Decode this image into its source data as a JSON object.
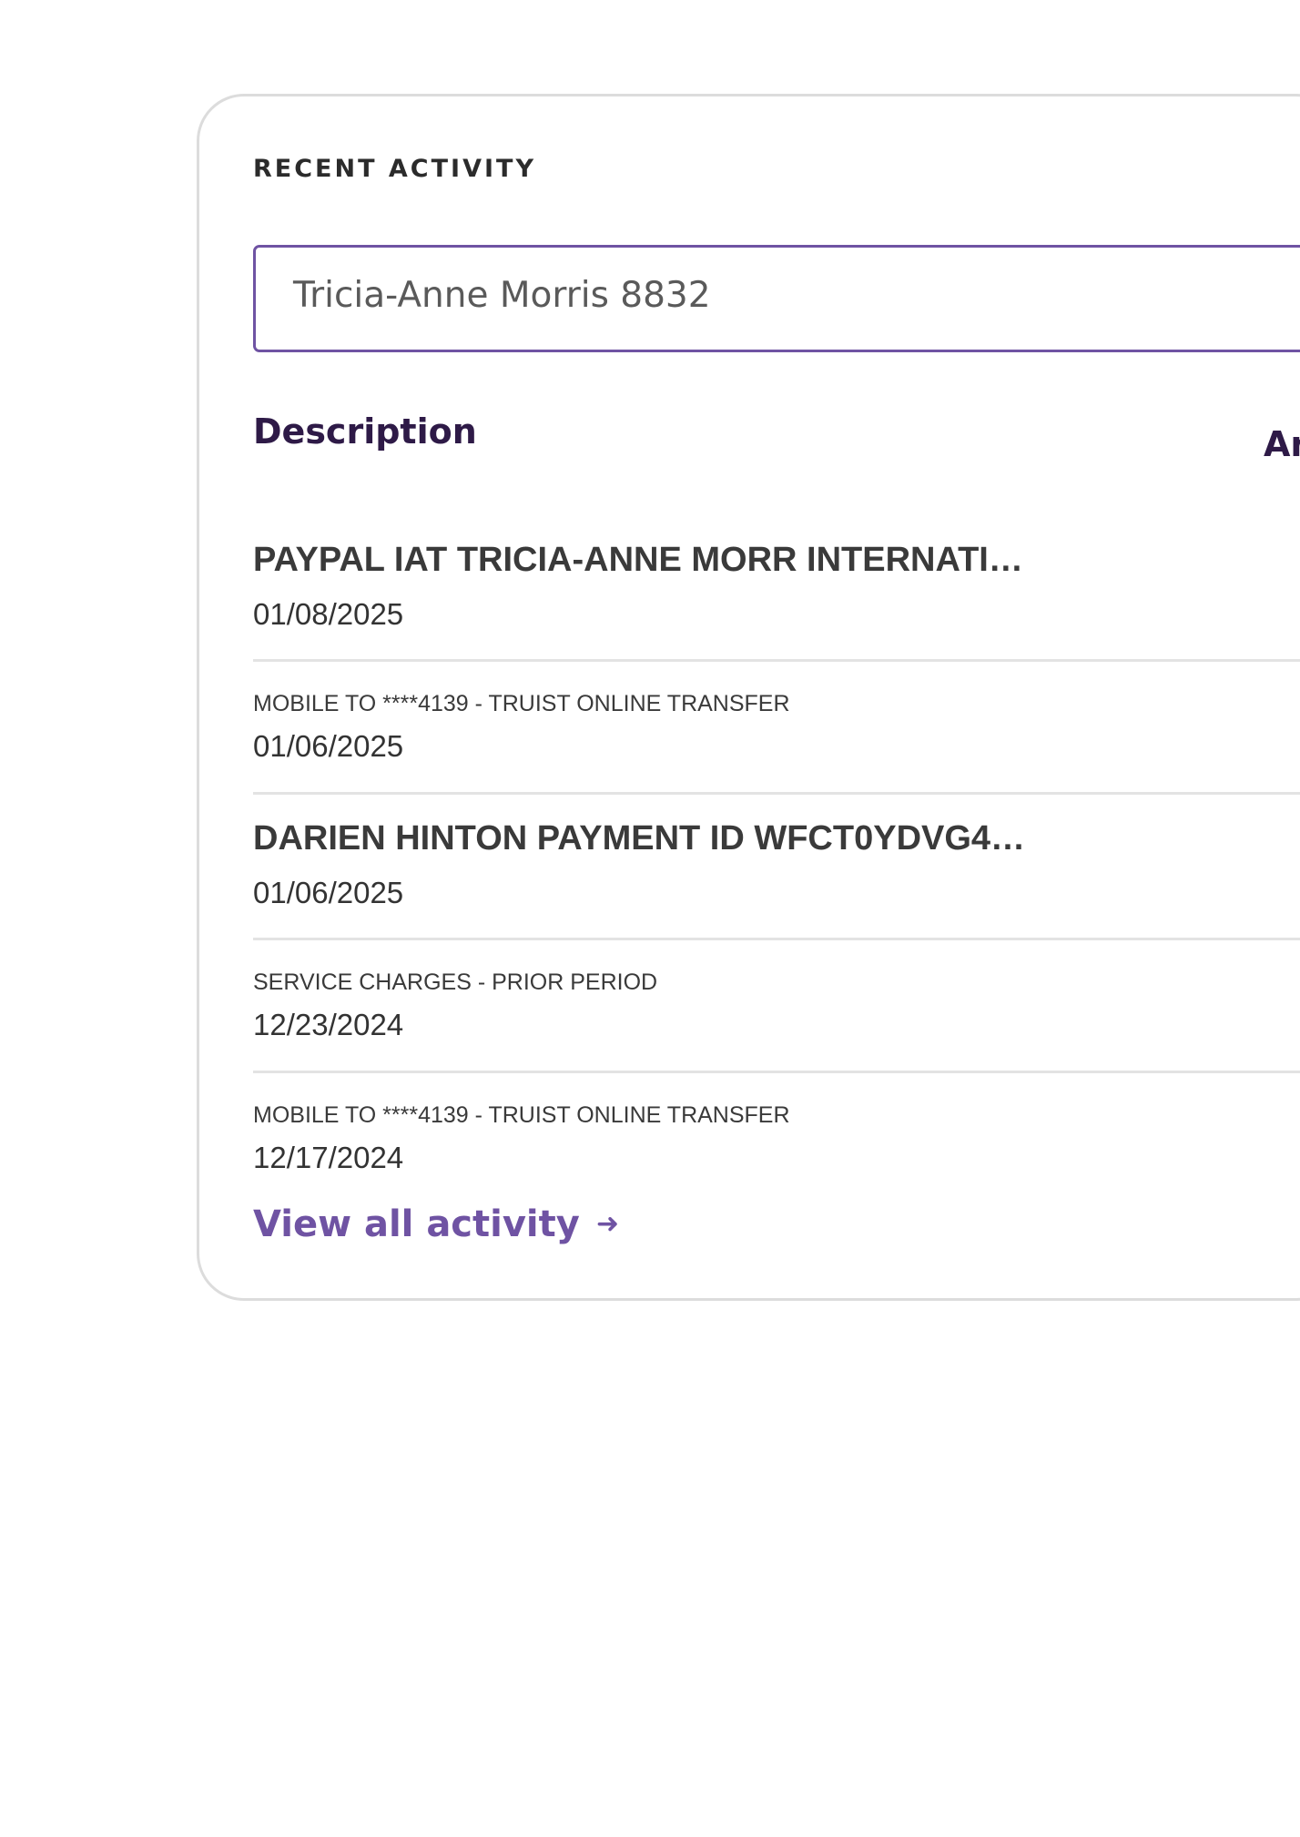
{
  "recent_activity": {
    "title": "RECENT ACTIVITY",
    "account_select": {
      "value": "Tricia-Anne Morris 8832"
    },
    "columns": {
      "description": "Description",
      "amount": "Ar"
    },
    "transactions": [
      {
        "description": "PAYPAL IAT TRICIA-ANNE MORR INTERNATI…",
        "date": "01/08/2025"
      },
      {
        "description": "MOBILE TO ****4139 - TRUIST ONLINE TRANSFER",
        "date": "01/06/2025"
      },
      {
        "description": "DARIEN HINTON PAYMENT ID WFCT0YDVG4…",
        "date": "01/06/2025"
      },
      {
        "description": "SERVICE CHARGES - PRIOR PERIOD",
        "date": "12/23/2024"
      },
      {
        "description": "MOBILE TO ****4139 - TRUIST ONLINE TRANSFER",
        "date": "12/17/2024"
      }
    ],
    "view_all": {
      "label": "View all activity",
      "icon": "arrow-right-icon"
    }
  }
}
